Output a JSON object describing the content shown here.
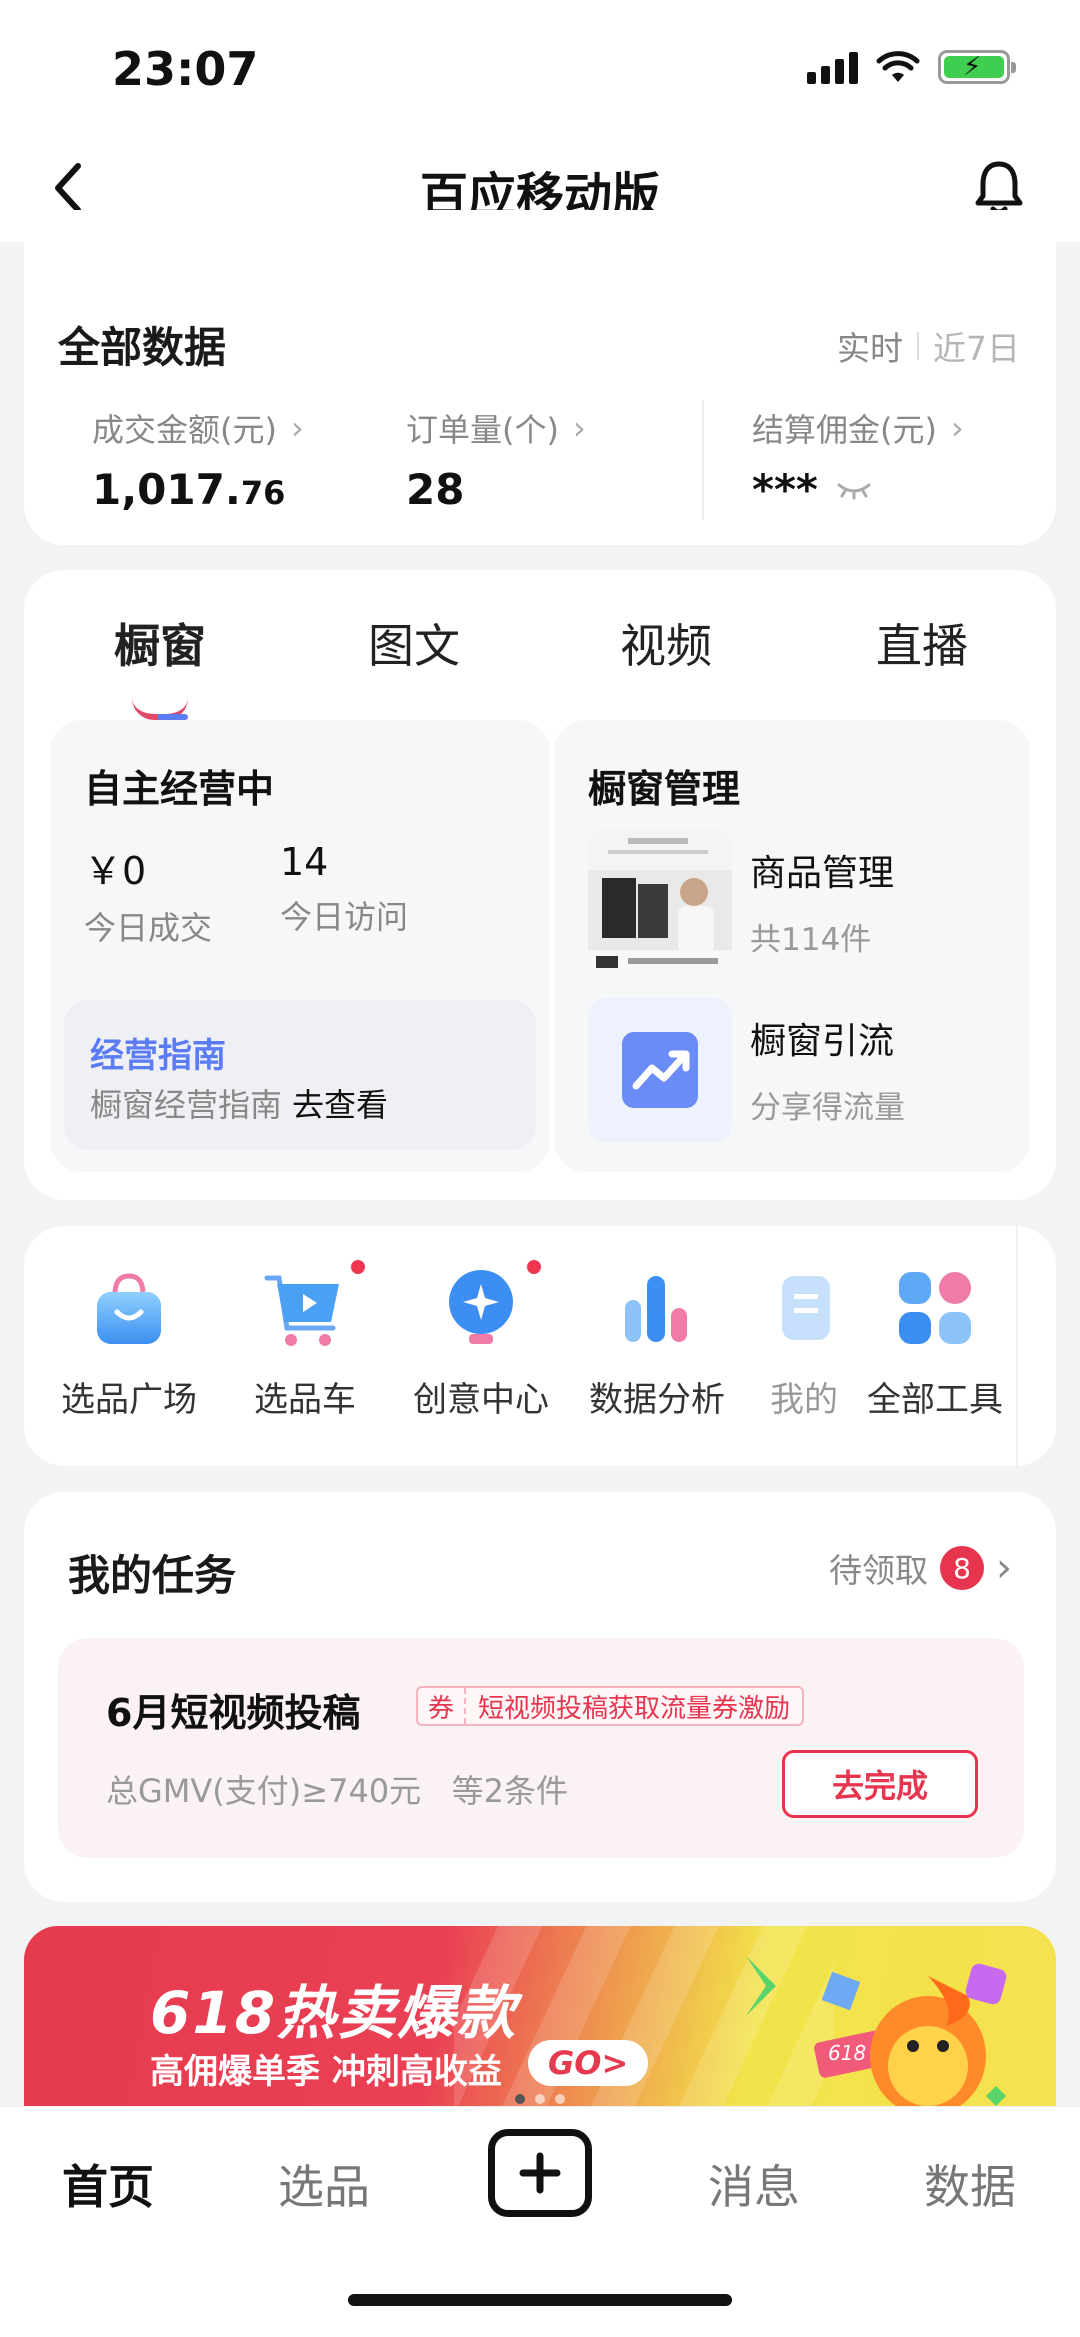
{
  "status": {
    "time": "23:07"
  },
  "nav": {
    "title": "百应移动版"
  },
  "overview": {
    "title": "全部数据",
    "range_active": "实时",
    "range_other": "近7日",
    "metrics": [
      {
        "label": "成交金额(元)",
        "value_int": "1,017.",
        "value_dec": "76"
      },
      {
        "label": "订单量(个)",
        "value": "28"
      },
      {
        "label": "结算佣金(元)",
        "value": "***"
      }
    ]
  },
  "tabs": [
    "橱窗",
    "图文",
    "视频",
    "直播"
  ],
  "self_run": {
    "title": "自主经营中",
    "stats": [
      {
        "value": "￥0",
        "label": "今日成交"
      },
      {
        "value": "14",
        "label": "今日访问"
      }
    ],
    "guide_title": "经营指南",
    "guide_text": "橱窗经营指南",
    "guide_link": "去查看"
  },
  "showcase_mgmt": {
    "title": "橱窗管理",
    "items": [
      {
        "name": "商品管理",
        "sub": "共114件",
        "icon": "product-thumbnail"
      },
      {
        "name": "橱窗引流",
        "sub": "分享得流量",
        "icon": "trend-up-icon"
      }
    ]
  },
  "tools": [
    {
      "label": "选品广场",
      "icon": "shopping-bag-icon",
      "dot": false
    },
    {
      "label": "选品车",
      "icon": "cart-icon",
      "dot": true
    },
    {
      "label": "创意中心",
      "icon": "bulb-icon",
      "dot": true
    },
    {
      "label": "数据分析",
      "icon": "bar-chart-icon",
      "dot": false
    },
    {
      "label": "我的",
      "icon": "doc-icon",
      "dot": false
    },
    {
      "label": "全部工具",
      "icon": "grid-icon",
      "dot": false
    }
  ],
  "tasks": {
    "title": "我的任务",
    "pending_label": "待领取",
    "pending_count": "8",
    "item": {
      "name": "6月短视频投稿",
      "coupon_tag": "券",
      "coupon_text": "短视频投稿获取流量券激励",
      "condition": "总GMV(支付)≥740元   等2条件",
      "action": "去完成"
    }
  },
  "banner": {
    "title": "618热卖爆款",
    "subtitle": "高佣爆单季 冲刺高收益",
    "go": "GO>",
    "art_label": "618"
  },
  "tabbar": {
    "items": [
      "首页",
      "选品",
      "消息",
      "数据"
    ],
    "active": "首页"
  },
  "colors": {
    "accent": "#e8354f",
    "link": "#5b7cf4"
  }
}
